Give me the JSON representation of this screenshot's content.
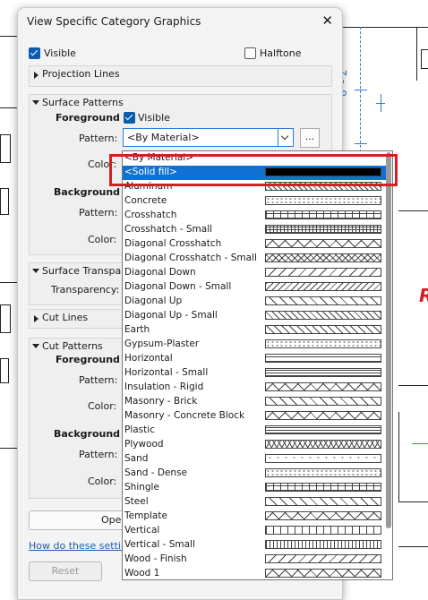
{
  "dialog": {
    "title": "View Specific Category Graphics",
    "visible_label": "Visible",
    "halftone_label": "Halftone",
    "projection_lines": "Projection Lines",
    "surface_patterns": {
      "header": "Surface Patterns",
      "foreground": "Foreground",
      "fg_visible": "Visible",
      "pattern_label": "Pattern:",
      "pattern_value": "<By Material>",
      "ellipsis": "...",
      "color_label": "Color:",
      "background": "Background",
      "bg_pattern_label": "Pattern:",
      "bg_color_label": "Color:"
    },
    "surface_transparency": {
      "header": "Surface Transpare",
      "transparency_label": "Transparency:"
    },
    "cut_lines": "Cut Lines",
    "cut_patterns": {
      "header": "Cut Patterns",
      "foreground": "Foreground",
      "pattern_label": "Pattern:",
      "color_label": "Color:",
      "background": "Background",
      "bg_pattern_label": "Pattern:",
      "bg_color_label": "Color:"
    },
    "open_button": "Oper",
    "help_link": "How do these settings",
    "reset_button": "Reset"
  },
  "background_drawing": {
    "dimension": "6' - 2\"",
    "red_text": "R"
  },
  "pattern_list": {
    "items": [
      {
        "name": "<By Material>",
        "swatch": "none"
      },
      {
        "name": "<Solid fill>",
        "swatch": "solid",
        "selected": true
      },
      {
        "name": "Aluminum",
        "swatch": "diag-dense"
      },
      {
        "name": "Concrete",
        "swatch": "dots"
      },
      {
        "name": "Crosshatch",
        "swatch": "grid"
      },
      {
        "name": "Crosshatch - Small",
        "swatch": "grid-small"
      },
      {
        "name": "Diagonal Crosshatch",
        "swatch": "diag-cross"
      },
      {
        "name": "Diagonal Crosshatch - Small",
        "swatch": "diag-cross-small"
      },
      {
        "name": "Diagonal Down",
        "swatch": "diag-down"
      },
      {
        "name": "Diagonal Down - Small",
        "swatch": "diag-down-small"
      },
      {
        "name": "Diagonal Up",
        "swatch": "diag-up"
      },
      {
        "name": "Diagonal Up - Small",
        "swatch": "diag-up-small"
      },
      {
        "name": "Earth",
        "swatch": "earth"
      },
      {
        "name": "Gypsum-Plaster",
        "swatch": "dots"
      },
      {
        "name": "Horizontal",
        "swatch": "horizontal"
      },
      {
        "name": "Horizontal - Small",
        "swatch": "horizontal-small"
      },
      {
        "name": "Insulation - Rigid",
        "swatch": "diag-cross"
      },
      {
        "name": "Masonry - Brick",
        "swatch": "diag-up"
      },
      {
        "name": "Masonry - Concrete  Block",
        "swatch": "diag-cross"
      },
      {
        "name": "Plastic",
        "swatch": "horizontal-small"
      },
      {
        "name": "Plywood",
        "swatch": "chevron"
      },
      {
        "name": "Sand",
        "swatch": "dots-sparse"
      },
      {
        "name": "Sand - Dense",
        "swatch": "dots"
      },
      {
        "name": "Shingle",
        "swatch": "grid"
      },
      {
        "name": "Steel",
        "swatch": "diag-up"
      },
      {
        "name": "Template",
        "swatch": "diag-cross"
      },
      {
        "name": "Vertical",
        "swatch": "vertical"
      },
      {
        "name": "Vertical - Small",
        "swatch": "vertical-small"
      },
      {
        "name": "Wood - Finish",
        "swatch": "diag-down"
      },
      {
        "name": "Wood 1",
        "swatch": "diag-cross"
      }
    ]
  },
  "colors": {
    "selection": "#0f72d2",
    "highlight_box": "#d42020",
    "accent_blue": "#2b7bd6"
  }
}
